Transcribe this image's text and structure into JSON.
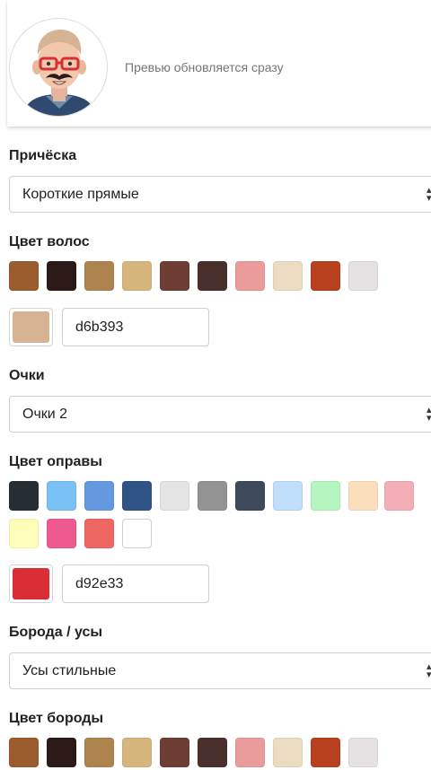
{
  "preview": {
    "text": "Превью обновляется сразу",
    "avatar_icon": "bearded-man-with-glasses-avatar"
  },
  "hair_style": {
    "label": "Причёска",
    "selected": "Короткие прямые"
  },
  "hair_color": {
    "label": "Цвет волос",
    "swatches": [
      "#9b5c2e",
      "#2b1a17",
      "#ae844e",
      "#d6b67d",
      "#6e3e35",
      "#4a302d",
      "#e99c9a",
      "#ebdcc1",
      "#b9401f",
      "#e6e2e3"
    ],
    "current_color": "#d6b393",
    "hex_value": "d6b393"
  },
  "glasses": {
    "label": "Очки",
    "selected": "Очки 2"
  },
  "frame_color": {
    "label": "Цвет оправы",
    "swatches_row1": [
      "#262e33",
      "#7ac2f5",
      "#6599df",
      "#2e5384",
      "#e4e4e4",
      "#939393",
      "#3c4a5c",
      "#bfdef9",
      "#b4f5c0",
      "#fbdfbd",
      "#f4aeb6"
    ],
    "swatches_row2": [
      "#fefeb9",
      "#ee5990",
      "#ef6763",
      "#ffffff"
    ],
    "current_color": "#d92e33",
    "hex_value": "d92e33"
  },
  "beard": {
    "label": "Борода / усы",
    "selected": "Усы стильные"
  },
  "beard_color": {
    "label": "Цвет бороды",
    "swatches": [
      "#9b5c2e",
      "#2b1a17",
      "#ae844e",
      "#d6b67d",
      "#6e3e35",
      "#4a302d",
      "#e99c9a",
      "#ebdcc1",
      "#b9401f",
      "#e6e2e3"
    ]
  }
}
